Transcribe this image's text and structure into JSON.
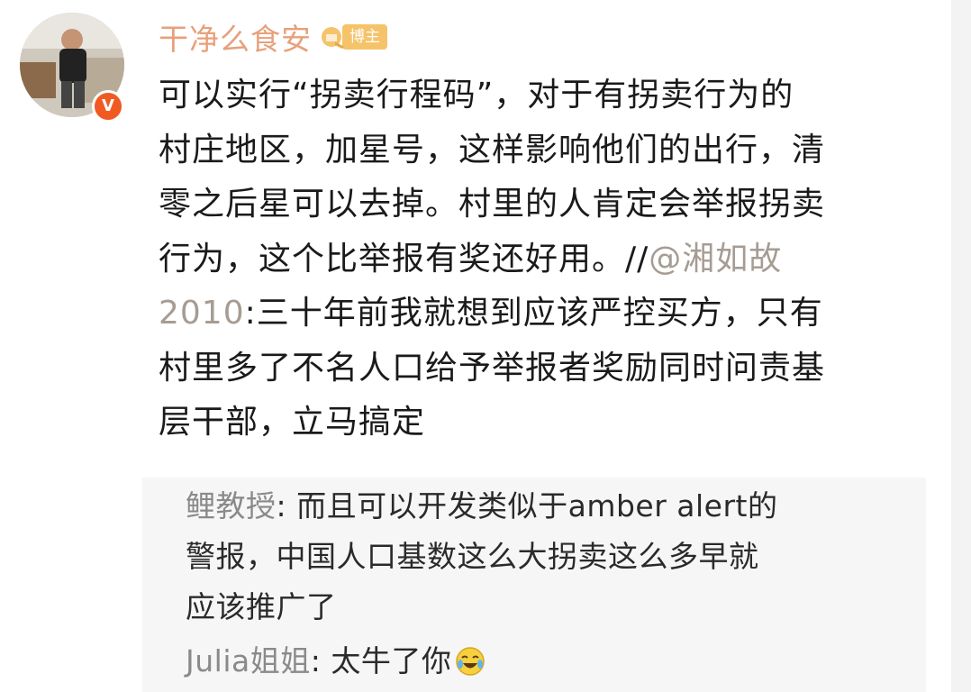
{
  "post": {
    "username": "干净么食安",
    "badge_label": "博主",
    "verified_mark": "V",
    "body_lines": [
      "可以实行“拐卖行程码”，对于有拐卖行为的",
      "村庄地区，加星号，这样影响他们的出行，清",
      "零之后星可以去掉。村里的人肯定会举报拐卖",
      "行为，这个比举报有奖还好用。//"
    ],
    "mention_part1": "@湘如故",
    "mention_part2": "2010",
    "quote_line1_rest": ":三十年前我就想到应该严控买方，只有",
    "quote_lines": [
      "村里多了不名人口给予举报者奖励同时问责基",
      "层干部，立马搞定"
    ]
  },
  "comments": [
    {
      "author": "鲤教授",
      "lines": [
        ": 而且可以开发类似于amber alert的",
        "警报，中国人口基数这么大拐卖这么多早就",
        "应该推广了"
      ]
    },
    {
      "author": "Julia姐姐",
      "text": ": 太牛了你",
      "emoji": "laughing-tears-icon"
    }
  ],
  "colors": {
    "username": "#e8a07a",
    "mention": "#a69c93",
    "comment_author": "#8a8a8a",
    "badge": "#f4c36a",
    "verified": "#f05a22",
    "reply_bg": "#f6f6f6"
  }
}
